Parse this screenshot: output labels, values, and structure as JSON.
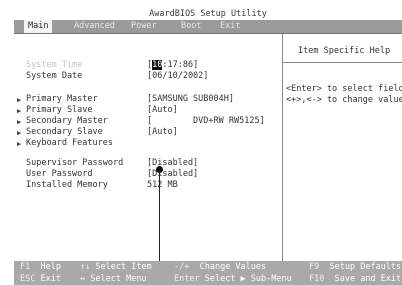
{
  "title": "AwardBIOS Setup Utility",
  "menu": [
    {
      "label": "Main",
      "active": true
    },
    {
      "label": "Advanced",
      "active": false
    },
    {
      "label": "Power",
      "active": false
    },
    {
      "label": "Boot",
      "active": false
    },
    {
      "label": "Exit",
      "active": false
    }
  ],
  "settings": {
    "system_time": {
      "label": "System Time",
      "cursor": "10",
      "value_rest": ":17:86]",
      "open": "["
    },
    "system_date": {
      "label": "System Date",
      "value": "[06/10/2002]"
    },
    "primary_master": {
      "label": "Primary Master",
      "value": "[SAMSUNG SUB004H]"
    },
    "primary_slave": {
      "label": "Primary Slave",
      "value": "[Auto]"
    },
    "secondary_master": {
      "label": "Secondary Master",
      "value": "[        DVD+RW RW5125]"
    },
    "secondary_slave": {
      "label": "Secondary Slave",
      "value": "[Auto]"
    },
    "keyboard_features": {
      "label": "Keyboard Features"
    },
    "supervisor_password": {
      "label": "Supervisor Password",
      "value": "[Disabled]"
    },
    "user_password": {
      "label": "User Password",
      "value": "[Disabled]"
    },
    "installed_memory": {
      "label": "Installed Memory",
      "value": "512 MB"
    }
  },
  "submenu_arrow": "▶",
  "help": {
    "title": "Item Specific Help",
    "line1": "<Enter> to select field;",
    "line2": "<+>,<-> to change value."
  },
  "footer": {
    "row1": [
      {
        "key": "F1",
        "desc": "Help"
      },
      {
        "key": "↑↓",
        "desc": "Select Item"
      },
      {
        "key": "-/+",
        "desc": "Change Values"
      },
      {
        "key": "F9",
        "desc": "Setup Defaults"
      }
    ],
    "row2": [
      {
        "key": "ESC",
        "desc": "Exit"
      },
      {
        "key": "↔",
        "desc": "Select Menu"
      },
      {
        "key": "Enter",
        "desc": "Select ▶ Sub-Menu"
      },
      {
        "key": "F10",
        "desc": "Save and Exit"
      }
    ]
  }
}
